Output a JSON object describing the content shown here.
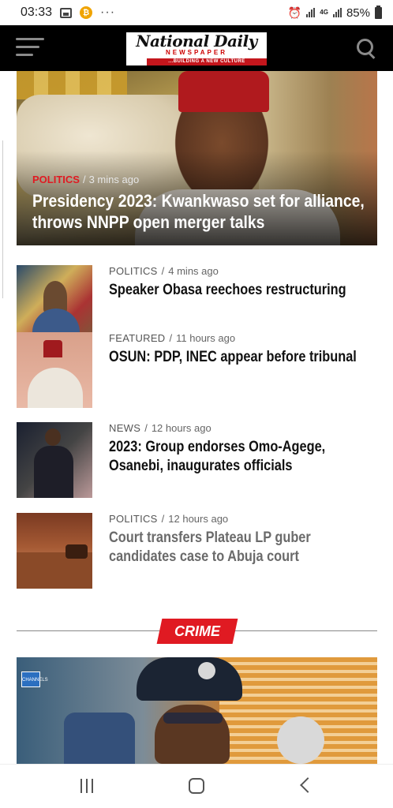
{
  "status_bar": {
    "time": "03:33",
    "battery": "85%",
    "network": "4G",
    "icons": [
      "gallery-icon",
      "coin-icon",
      "more-dots-icon",
      "alarm-icon",
      "signal-icon",
      "battery-icon"
    ]
  },
  "header": {
    "logo_main": "National Daily",
    "logo_sub": "NEWSPAPER",
    "logo_tagline": "...BUILDING A NEW CULTURE",
    "menu_icon": "hamburger-icon",
    "search_icon": "search-icon"
  },
  "hero": {
    "category": "POLITICS",
    "time": "3 mins ago",
    "title": "Presidency 2023: Kwankwaso set for alliance, throws NNPP open merger talks",
    "colors": {
      "category": "#e01a22"
    }
  },
  "articles": [
    {
      "category": "POLITICS",
      "time": "4 mins ago",
      "title": "Speaker Obasa reechoes restructuring"
    },
    {
      "category": "FEATURED",
      "time": "11 hours ago",
      "title": "OSUN: PDP, INEC appear before tribunal"
    },
    {
      "category": "NEWS",
      "time": "12 hours ago",
      "title": "2023: Group endorses Omo-Agege, Osanebi, inaugurates officials"
    },
    {
      "category": "POLITICS",
      "time": "12 hours ago",
      "title": "Court transfers Plateau LP guber candidates case to Abuja court"
    }
  ],
  "section": {
    "label": "CRIME",
    "color": "#e01a22"
  },
  "crime_hero": {
    "watermark": "CHANNELS"
  },
  "nav_bar": {
    "icons": [
      "recents-icon",
      "home-icon",
      "back-icon"
    ]
  },
  "separator": "/"
}
